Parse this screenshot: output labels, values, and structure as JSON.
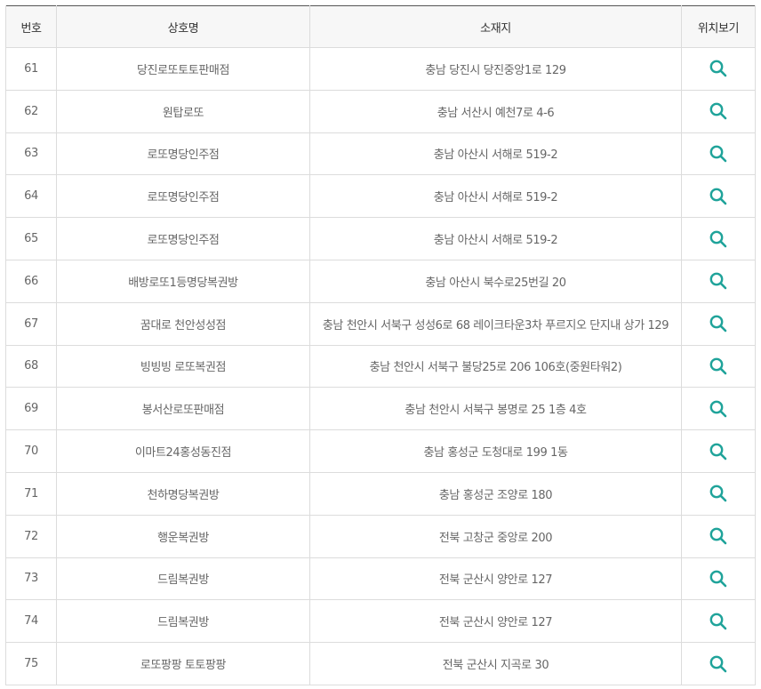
{
  "table": {
    "headers": {
      "no": "번호",
      "name": "상호명",
      "address": "소재지",
      "location": "위치보기"
    },
    "rows": [
      {
        "no": "61",
        "name": "당진로또토토판매점",
        "address": "충남 당진시 당진중앙1로 129"
      },
      {
        "no": "62",
        "name": "원탑로또",
        "address": "충남 서산시 예천7로 4-6"
      },
      {
        "no": "63",
        "name": "로또명당인주점",
        "address": "충남 아산시 서해로 519-2"
      },
      {
        "no": "64",
        "name": "로또명당인주점",
        "address": "충남 아산시 서해로 519-2"
      },
      {
        "no": "65",
        "name": "로또명당인주점",
        "address": "충남 아산시 서해로 519-2"
      },
      {
        "no": "66",
        "name": "배방로또1등명당복권방",
        "address": "충남 아산시 북수로25번길 20"
      },
      {
        "no": "67",
        "name": "꿈대로 천안성성점",
        "address": "충남 천안시 서북구 성성6로 68 레이크타운3차 푸르지오 단지내 상가 129"
      },
      {
        "no": "68",
        "name": "빙빙빙 로또복권점",
        "address": "충남 천안시 서북구 불당25로 206 106호(중원타워2)"
      },
      {
        "no": "69",
        "name": "봉서산로또판매점",
        "address": "충남 천안시 서북구 봉명로 25 1층 4호"
      },
      {
        "no": "70",
        "name": "이마트24홍성동진점",
        "address": "충남 홍성군 도청대로 199 1동"
      },
      {
        "no": "71",
        "name": "천하명당복권방",
        "address": "충남 홍성군 조양로 180"
      },
      {
        "no": "72",
        "name": "행운복권방",
        "address": "전북 고창군 중앙로 200"
      },
      {
        "no": "73",
        "name": "드림복권방",
        "address": "전북 군산시 양안로 127"
      },
      {
        "no": "74",
        "name": "드림복권방",
        "address": "전북 군산시 양안로 127"
      },
      {
        "no": "75",
        "name": "로또팡팡 토토팡팡",
        "address": "전북 군산시 지곡로 30"
      }
    ]
  },
  "icons": {
    "location": "search-icon"
  },
  "colors": {
    "icon": "#1fa39a",
    "header_bg": "#f7f7f7",
    "text": "#666666",
    "header_text": "#333333",
    "border": "#dcdcdc"
  }
}
